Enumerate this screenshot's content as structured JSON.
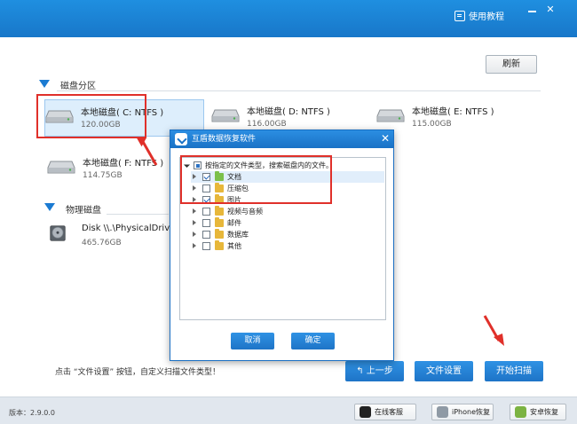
{
  "window": {
    "help_label": "使用教程"
  },
  "toolbar": {
    "refresh_label": "刷新"
  },
  "sections": {
    "partitions_label": "磁盘分区",
    "physical_label": "物理磁盘"
  },
  "partitions": [
    {
      "name": "本地磁盘( C: NTFS )",
      "size": "120.00GB"
    },
    {
      "name": "本地磁盘( D: NTFS )",
      "size": "116.00GB"
    },
    {
      "name": "本地磁盘( E: NTFS )",
      "size": "115.00GB"
    },
    {
      "name": "本地磁盘( F: NTFS )",
      "size": "114.75GB"
    }
  ],
  "physical_disks": [
    {
      "name": "Disk \\\\.\\PhysicalDrive",
      "size": "465.76GB"
    }
  ],
  "dialog": {
    "title": "互盾数据恢复软件",
    "root_label": "按指定的文件类型，搜索磁盘内的文件。",
    "items": [
      {
        "label": "文档",
        "checked": true
      },
      {
        "label": "压缩包",
        "checked": false
      },
      {
        "label": "图片",
        "checked": true
      },
      {
        "label": "视频与音频",
        "checked": false
      },
      {
        "label": "邮件",
        "checked": false
      },
      {
        "label": "数据库",
        "checked": false
      },
      {
        "label": "其他",
        "checked": false
      }
    ],
    "cancel_label": "取消",
    "ok_label": "确定"
  },
  "footer": {
    "hint": "点击 “文件设置” 按钮，自定义扫描文件类型！",
    "prev_label": "上一步",
    "file_settings_label": "文件设置",
    "start_scan_label": "开始扫描"
  },
  "statusbar": {
    "version": "版本：2.9.0.0",
    "qq_label": "在线客服",
    "iphone_label": "iPhone恢复",
    "android_label": "安卓恢复"
  },
  "colors": {
    "accent": "#1b7bd2",
    "annotation": "#e0302a"
  }
}
